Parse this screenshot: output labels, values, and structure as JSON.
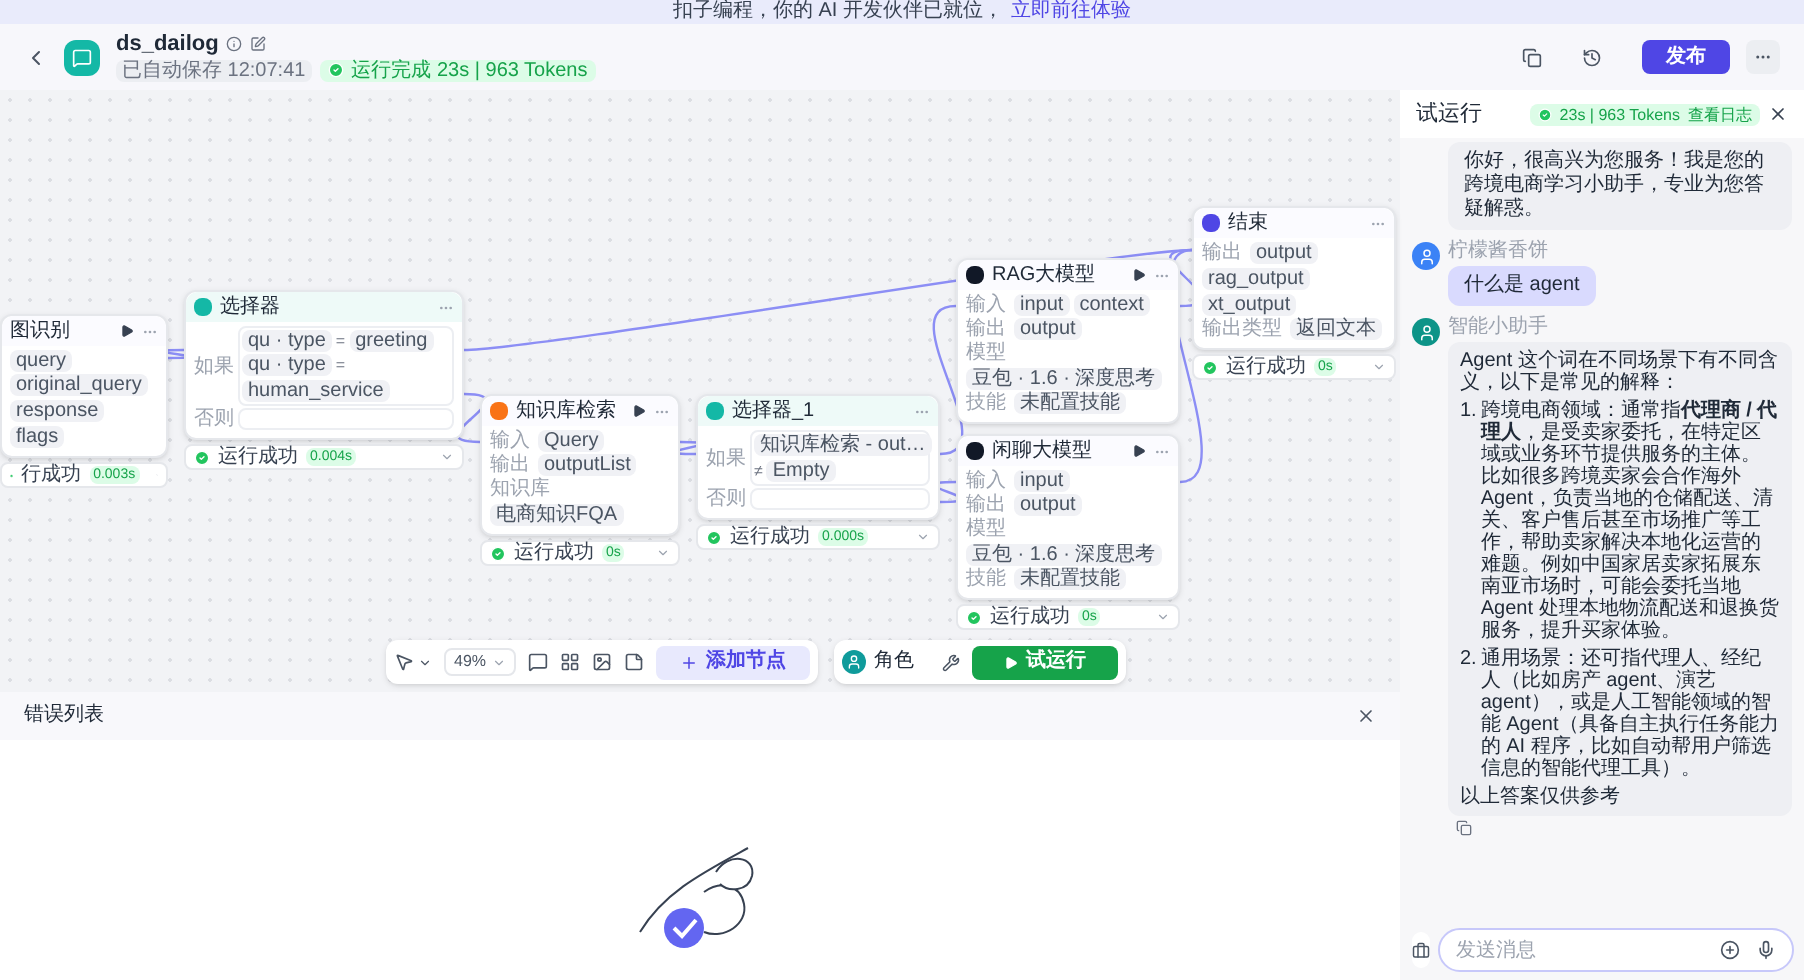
{
  "banner": {
    "text": "扣子编程，你的 AI 开发伙伴已就位，",
    "link": "立即前往体验"
  },
  "header": {
    "title": "ds_dailog",
    "saved": "已自动保存 12:07:41",
    "run_badge": "运行完成 23s | 963 Tokens",
    "publish": "发布"
  },
  "nodes": [
    {
      "kind": "fields",
      "title": "图识别",
      "runnable": true,
      "rows": [
        {
          "chips": [
            "query"
          ]
        },
        {
          "chips": [
            "original_query",
            "response",
            "flags"
          ]
        }
      ],
      "status": "行成功",
      "time": "0.003s"
    },
    {
      "kind": "condition",
      "title": "选择器",
      "color": "#14b8a6",
      "if_label": "如果",
      "else_label": "否则",
      "conditions": [
        {
          "left": "qu · type",
          "op": "=",
          "right": "greeting"
        },
        {
          "left": "qu · type",
          "op": "=",
          "right": "human_service"
        }
      ],
      "status": "运行成功",
      "time": "0.004s"
    },
    {
      "kind": "fields",
      "title": "知识库检索",
      "color": "#f97316",
      "runnable": true,
      "rows": [
        {
          "label": "输入",
          "chips": [
            "Query"
          ]
        },
        {
          "label": "输出",
          "chips": [
            "outputList"
          ]
        },
        {
          "label": "知识库",
          "chips": [
            "电商知识FQA"
          ]
        }
      ],
      "status": "运行成功",
      "time": "0s"
    },
    {
      "kind": "condition",
      "title": "选择器_1",
      "color": "#14b8a6",
      "if_label": "如果",
      "else_label": "否则",
      "conditions": [
        {
          "left": "知识库检索 - out…",
          "op": "≠",
          "right": "Empty"
        }
      ],
      "status": "运行成功",
      "time": "0.000s"
    },
    {
      "kind": "fields",
      "title": "RAG大模型",
      "color": "#111827",
      "runnable": true,
      "rows": [
        {
          "label": "输入",
          "chips": [
            "input",
            "context"
          ]
        },
        {
          "label": "输出",
          "chips": [
            "output"
          ]
        },
        {
          "label": "模型",
          "chips": [
            "豆包 · 1.6 · 深度思考"
          ]
        },
        {
          "label": "技能",
          "chips": [
            "未配置技能"
          ]
        }
      ]
    },
    {
      "kind": "fields",
      "title": "闲聊大模型",
      "color": "#111827",
      "runnable": true,
      "rows": [
        {
          "label": "输入",
          "chips": [
            "input"
          ]
        },
        {
          "label": "输出",
          "chips": [
            "output"
          ]
        },
        {
          "label": "模型",
          "chips": [
            "豆包 · 1.6 · 深度思考"
          ]
        },
        {
          "label": "技能",
          "chips": [
            "未配置技能"
          ]
        }
      ],
      "status": "运行成功",
      "time": "0s"
    },
    {
      "kind": "fields",
      "title": "结束",
      "color": "#4f46e5",
      "rows": [
        {
          "label": "输出",
          "chips": [
            "output",
            "rag_output",
            "xt_output"
          ]
        },
        {
          "label": "输出类型",
          "chips": [
            "返回文本"
          ]
        }
      ],
      "status": "运行成功",
      "time": "0s"
    }
  ],
  "toolbar": {
    "zoom": "49%",
    "add_node": "添加节点",
    "role": "角色",
    "test_run": "试运行"
  },
  "error_panel": {
    "title": "错误列表"
  },
  "chat": {
    "title": "试运行",
    "badge": "23s | 963 Tokens",
    "log_link": "查看日志",
    "messages": [
      {
        "kind": "bot_text",
        "text": "你好，很高兴为您服务！我是您的跨境电商学习小助手，专业为您答疑解惑。"
      },
      {
        "kind": "user_text",
        "sender": "柠檬酱香饼",
        "text": "什么是 agent"
      },
      {
        "kind": "answer",
        "sender": "智能小助手",
        "intro": "Agent 这个词在不同场景下有不同含义，以下是常见的解释：",
        "items": [
          {
            "number": "1.",
            "text": "跨境电商领域：通常指**代理商 / 代理人**，是受卖家委托，在特定区域或业务环节提供服务的主体。比如很多跨境卖家会合作海外 Agent，负责当地的仓储配送、清关、客户售后甚至市场推广等工作，帮助卖家解决本地化运营的难题。例如中国家居卖家拓展东南亚市场时，可能会委托当地 Agent 处理本地物流配送和退换货服务，提升买家体验。"
          },
          {
            "number": "2.",
            "text": "通用场景：还可指代理人、经纪人（比如房产 agent、演艺 agent），或是人工智能领域的智能 Agent（具备自主执行任务能力的 AI 程序，比如自动帮用户筛选信息的智能代理工具）。"
          }
        ],
        "outro": "以上答案仅供参考"
      }
    ],
    "input": {
      "placeholder": "发送消息"
    }
  }
}
